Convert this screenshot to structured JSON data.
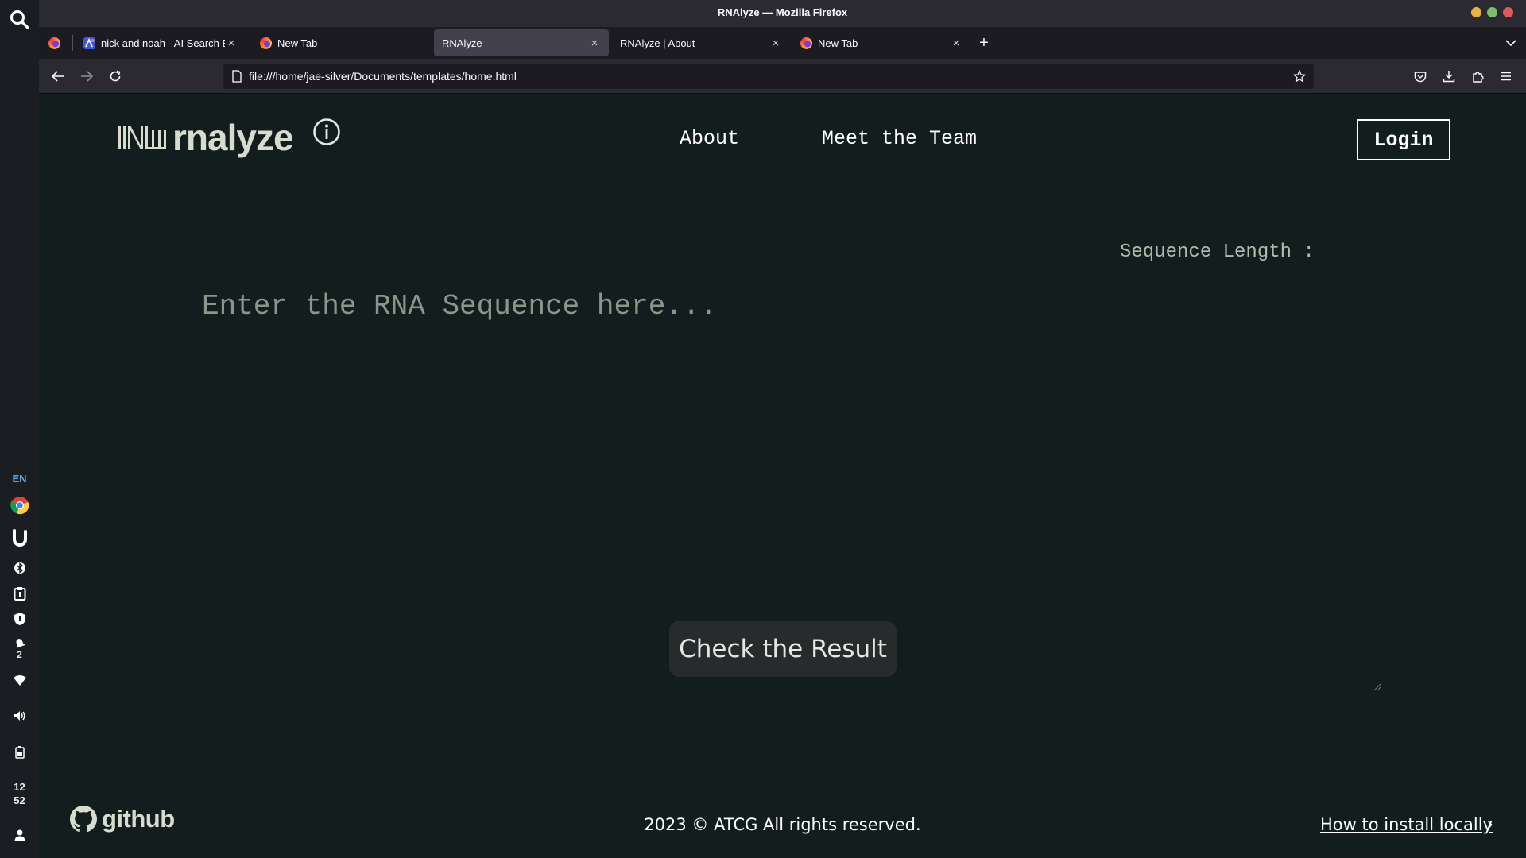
{
  "os_dock": {
    "language": "EN",
    "notification_count": "2",
    "clock_hour": "12",
    "clock_minute": "52",
    "icons": [
      "search-icon",
      "chrome-icon",
      "u-app-icon",
      "bluetooth-icon",
      "clipboard-icon",
      "shield-icon",
      "notification-bell-icon",
      "wifi-icon",
      "volume-icon",
      "battery-icon",
      "user-icon"
    ]
  },
  "browser": {
    "window_title": "RNAlyze — Mozilla Firefox",
    "tabs": [
      {
        "title": "nick and noah - AI Search Based Chat | AI for Search Engines",
        "active": false
      },
      {
        "title": "New Tab",
        "active": false
      },
      {
        "title": "RNAlyze",
        "active": true
      },
      {
        "title": "RNAlyze | About",
        "active": false
      },
      {
        "title": "New Tab",
        "active": false
      }
    ],
    "url": "file:///home/jae-silver/Documents/templates/home.html"
  },
  "page": {
    "logo_text": "rnalyze",
    "nav": {
      "about": "About",
      "team": "Meet the Team",
      "login": "Login"
    },
    "sequence_length_label": "Sequence Length :",
    "sequence_placeholder": "Enter the RNA Sequence here...",
    "check_button": "Check the Result",
    "footer": {
      "github": "github",
      "copyright": "2023 © ATCG All rights reserved.",
      "install_link": "How to install locally",
      "install_chevron": "›"
    }
  },
  "colors": {
    "page_bg": "#121e1e",
    "logo": "#d8dccf",
    "button_bg": "#282b2c"
  }
}
